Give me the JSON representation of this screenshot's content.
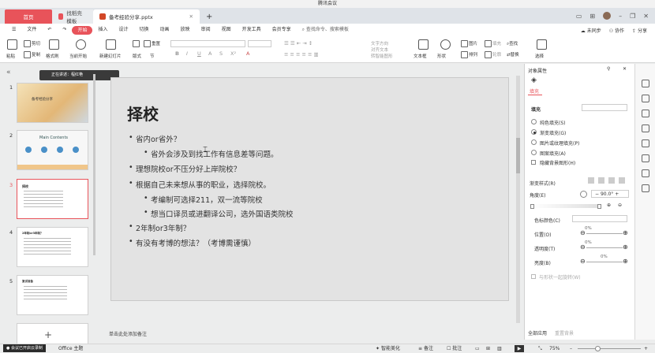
{
  "meeting": {
    "title": "腾讯会议"
  },
  "tabs": {
    "home": "首页",
    "template": "找稻壳模板",
    "doc": "备考经验分享.pptx"
  },
  "menu": {
    "file": "文件",
    "items": [
      "开始",
      "插入",
      "设计",
      "切换",
      "动画",
      "放映",
      "审阅",
      "视图",
      "开发工具",
      "会员专享"
    ],
    "search": "查找命令、搜索模板",
    "unsaved": "未同步",
    "collab": "协作",
    "share": "分享"
  },
  "ribbon": {
    "paste": "粘贴",
    "cut": "剪切",
    "copy": "复制",
    "format_painter": "格式刷",
    "from_start": "当前开始",
    "new_slide": "新建幻灯片",
    "layout": "版式",
    "section": "节",
    "reset": "重置",
    "textbox": "文本框",
    "shape": "形状",
    "arrange": "排列",
    "picture": "图片",
    "fill": "填充",
    "outline": "轮廓",
    "find": "查找",
    "replace": "替换",
    "select": "选择",
    "text_direction": "文字方向",
    "align_text": "对齐文本",
    "smartart": "转智能图形"
  },
  "left_panel": {
    "tooltip": "正在讲述：程红艳",
    "thumbs": [
      {
        "num": "1",
        "title": "备考经验分享"
      },
      {
        "num": "2",
        "title": "Main Contents"
      },
      {
        "num": "3",
        "title": "择校"
      },
      {
        "num": "4",
        "title": "2年制or3年制？"
      },
      {
        "num": "5",
        "title": "复试准备"
      }
    ],
    "add_icon": "+"
  },
  "slide": {
    "title": "择校",
    "bullets": [
      {
        "level": 1,
        "text": "省内or省外？"
      },
      {
        "level": 2,
        "text": "省外会涉及到找工作有信息差等问题。"
      },
      {
        "level": 1,
        "text": "理想院校or不压分好上岸院校？"
      },
      {
        "level": 1,
        "text": "根据自己未来想从事的职业，选择院校。"
      },
      {
        "level": 2,
        "text": "考编制可选择211，双一流等院校"
      },
      {
        "level": 2,
        "text": "想当口译员或进翻译公司，选外国语类院校"
      },
      {
        "level": 1,
        "text": "2年制or3年制？"
      },
      {
        "level": 1,
        "text": "有没有考博的想法？（考博需谨慎）"
      }
    ],
    "notes_placeholder": "单击此处添加备注"
  },
  "props": {
    "panel_title": "对象属性",
    "tab_fill": "填充",
    "section_fill": "填充",
    "options": [
      "纯色填充(S)",
      "渐变填充(G)",
      "图片或纹理填充(P)",
      "图案填充(A)"
    ],
    "selected_option": "渐变填充(G)",
    "hide_bg": "隐藏背景图形(H)",
    "gradient_style": "渐变样式(R)",
    "angle_label": "角度(E)",
    "angle_value": "90.0°",
    "color_label": "色标颜色(C)",
    "position_label": "位置(O)",
    "position_value": "0%",
    "transparency_label": "透明度(T)",
    "transparency_value": "0%",
    "brightness_label": "亮度(B)",
    "brightness_value": "0%",
    "rotate_with_shape": "与形状一起旋转(W)",
    "apply_all": "全部应用",
    "reset_bg": "重置背景"
  },
  "status": {
    "theme": "Office 主题",
    "meeting_notice": "会议已开启云录制",
    "beautify": "智能美化",
    "notes": "备注",
    "comments": "批注",
    "zoom": "75%"
  },
  "colors": {
    "accent": "#e8535a",
    "bg": "#eceded"
  }
}
